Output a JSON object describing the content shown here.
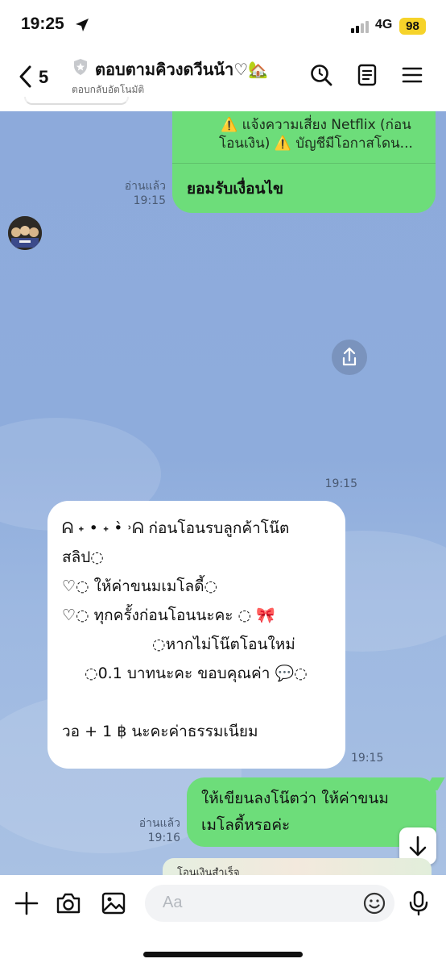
{
  "status_bar": {
    "time": "19:25",
    "network": "4G",
    "battery": "98"
  },
  "header": {
    "back_count": "5",
    "title": "ตอบตามคิวงดวีนน้า♡🏡",
    "subtitle": "ตอบกลับอัตโนมัติ"
  },
  "messages": {
    "m1": {
      "line1": "⚠️ แจ้งความเสี่ยง Netflix (ก่อน",
      "line2": "โอนเงิน) ⚠️ บัญชีมีโอกาสโดน...",
      "reply": "ยอมรับเงื่อนไข",
      "read": "อ่านแล้ว",
      "time": "19:15"
    },
    "m2": {
      "time": "19:15"
    },
    "m3": {
      "lines": [
        "ᕱ ˖ • ˖ •̀ ˒ᕱ  ก่อนโอนรบลูกค้าโน๊ต",
        "สลิป◌",
        "♡◌  ให้ค่าขนมเมโลดี้◌",
        "♡◌  ทุกครั้งก่อนโอนนะคะ ◌ 🎀",
        "◌หากไม่โน๊ตโอนใหม่",
        "◌0.1 บาทนะคะ ขอบคุณค่า 💬◌",
        "",
        "วอ + 1 ฿ นะคะค่าธรรมเนียม"
      ],
      "time": "19:15"
    },
    "m4": {
      "line1": "ให้เขียนลงโน๊ตว่า ให้ค่าขนม",
      "line2": "เมโลดี้หรอค่ะ",
      "read": "อ่านแล้ว",
      "time": "19:16"
    },
    "m5_preview": "โอนเงินสำเร็จ"
  },
  "input": {
    "placeholder": "Aa"
  },
  "colors": {
    "chat_bg": "#8daadb",
    "bubble_green": "#6ddd7a",
    "bubble_white": "#ffffff",
    "battery": "#f6d32a"
  },
  "icons": [
    "location-arrow-icon",
    "signal-icon",
    "chevron-left-icon",
    "shield-icon",
    "search-icon",
    "note-icon",
    "menu-icon",
    "share-icon",
    "arrow-down-icon",
    "plus-icon",
    "camera-icon",
    "image-icon",
    "emoji-icon",
    "microphone-icon"
  ]
}
